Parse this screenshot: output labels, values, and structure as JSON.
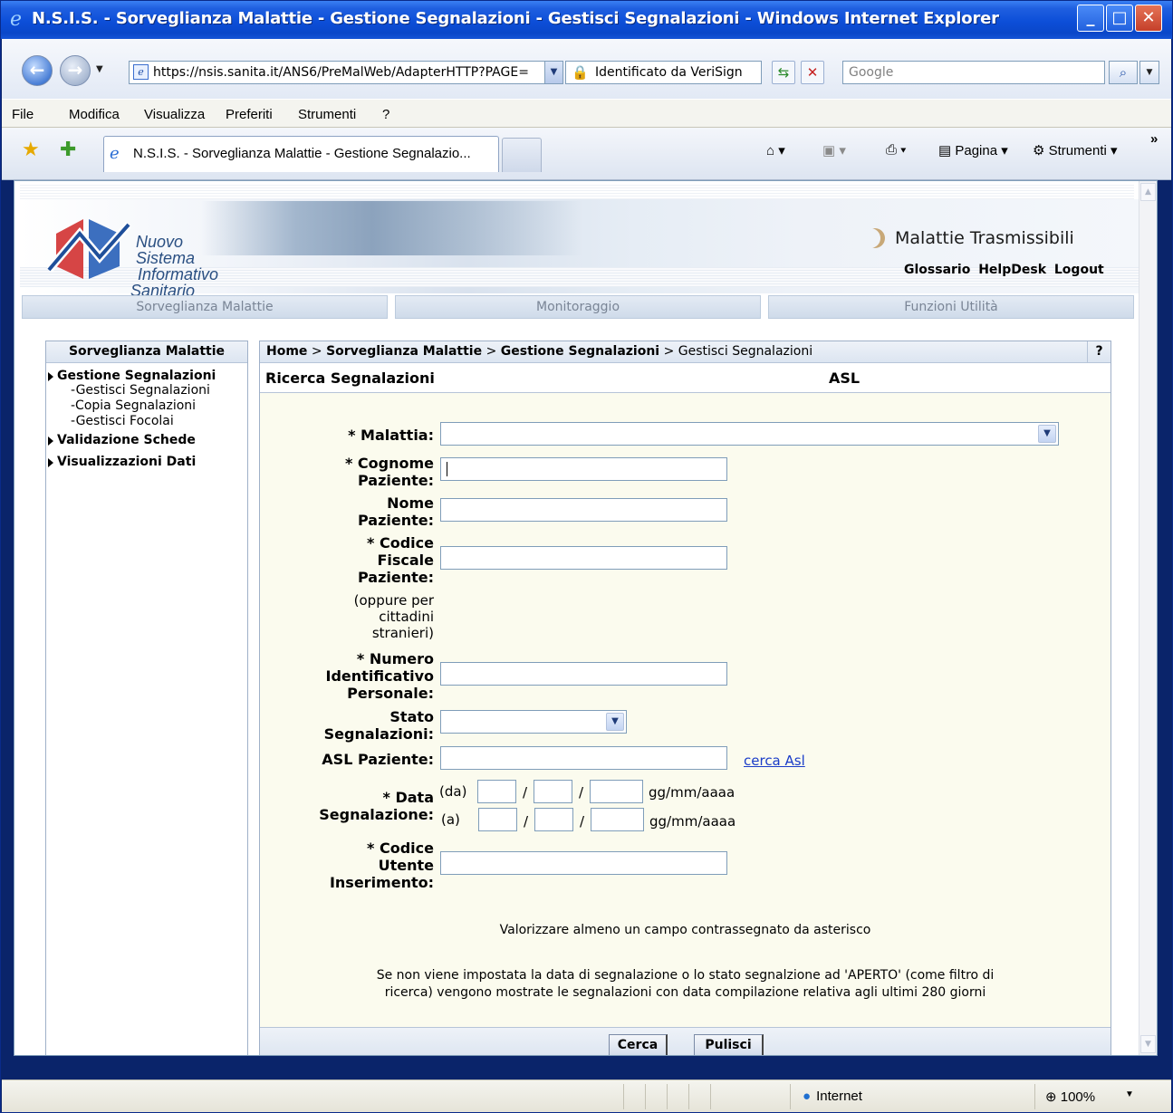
{
  "window": {
    "title": "N.S.I.S. - Sorveglianza Malattie - Gestione Segnalazioni - Gestisci Segnalazioni - Windows Internet Explorer",
    "minimize": "_",
    "maximize": "□",
    "close": "✕"
  },
  "toolbar": {
    "address": "https://nsis.sanita.it/ANS6/PreMalWeb/AdapterHTTP?PAGE=",
    "security": "Identificato da VeriSign",
    "search_placeholder": "Google"
  },
  "menu": [
    "File",
    "Modifica",
    "Visualizza",
    "Preferiti",
    "Strumenti",
    "?"
  ],
  "tabbar": {
    "tab_title": "N.S.I.S. - Sorveglianza Malattie - Gestione Segnalazio...",
    "page_label": "Pagina",
    "tools_label": "Strumenti"
  },
  "banner": {
    "logo_lines": [
      "Nuovo",
      "Sistema",
      "Informativo",
      "Sanitario"
    ],
    "app_title": "Malattie Trasmissibili",
    "links": [
      "Glossario",
      "HelpDesk",
      "Logout"
    ]
  },
  "main_nav": [
    "Sorveglianza Malattie",
    "Monitoraggio",
    "Funzioni Utilità"
  ],
  "sidebar": {
    "title": "Sorveglianza Malattie",
    "sections": [
      {
        "label": "Gestione Segnalazioni",
        "items": [
          "-Gestisci Segnalazioni",
          "-Copia Segnalazioni",
          "-Gestisci Focolai"
        ]
      },
      {
        "label": "Validazione Schede",
        "items": []
      },
      {
        "label": "Visualizzazioni Dati",
        "items": []
      }
    ]
  },
  "breadcrumb": {
    "home": "Home",
    "level1": "Sorveglianza Malattie",
    "level2": "Gestione Segnalazioni",
    "current": "Gestisci Segnalazioni",
    "separator": ">",
    "help": "?"
  },
  "form": {
    "title": "Ricerca Segnalazioni",
    "asl_header": "ASL",
    "malattia": {
      "label": "* Malattia:",
      "value": ""
    },
    "cognome": {
      "label_lines": [
        "* Cognome",
        "Paziente:"
      ],
      "value": ""
    },
    "nome": {
      "label_lines": [
        "Nome",
        "Paziente:"
      ],
      "value": ""
    },
    "codice_fiscale": {
      "label_lines": [
        "* Codice",
        "Fiscale",
        "Paziente:"
      ],
      "value": ""
    },
    "note_stranieri": [
      "(oppure per",
      "cittadini",
      "stranieri)"
    ],
    "numero_id": {
      "label_lines": [
        "* Numero",
        "Identificativo",
        "Personale:"
      ],
      "value": ""
    },
    "stato": {
      "label_lines": [
        "Stato",
        "Segnalazioni:"
      ],
      "value": ""
    },
    "asl_paziente": {
      "label": "ASL Paziente:",
      "value": "",
      "link": "cerca Asl"
    },
    "data_segnalazione": {
      "label_lines": [
        "* Data",
        "Segnalazione:"
      ],
      "from_label": "(da)",
      "to_label": "(a)",
      "sep": "/",
      "format": "gg/mm/aaaa"
    },
    "codice_utente": {
      "label_lines": [
        "* Codice",
        "Utente",
        "Inserimento:"
      ],
      "value": ""
    },
    "info_required": "Valorizzare almeno un campo contrassegnato da asterisco",
    "info_filter_lines": [
      "Se non viene impostata la data di segnalazione o lo stato segnalzione ad 'APERTO' (come filtro di",
      "ricerca) vengono mostrate le segnalazioni con data compilazione relativa agli ultimi 280 giorni"
    ],
    "search_button": "Cerca",
    "reset_button": "Pulisci"
  },
  "statusbar": {
    "zone": "Internet",
    "zoom": "100%"
  },
  "colors": {
    "titlebar": "#0c4ed8",
    "panel_bg": "#fbfbee",
    "link": "#1a3cc8",
    "header_bg": "#dce5f1"
  }
}
